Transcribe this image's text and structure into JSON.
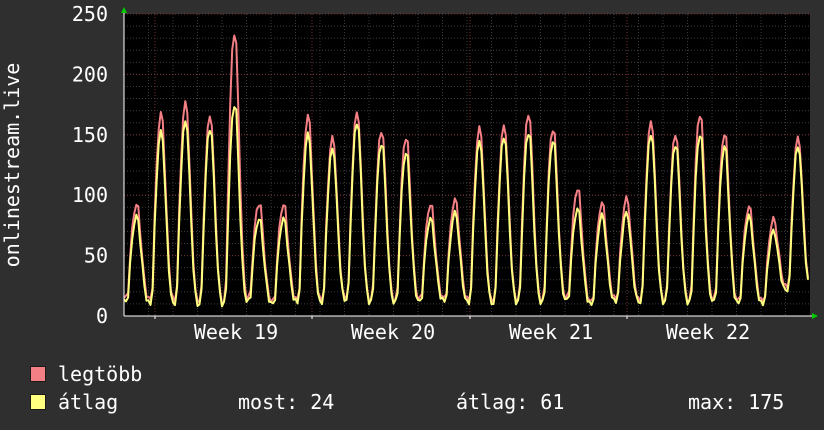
{
  "chart_data": {
    "type": "line",
    "ylabel": "onlinestream.live",
    "xlabel": "",
    "ylim": [
      0,
      250
    ],
    "yticks": [
      0,
      50,
      100,
      150,
      200,
      250
    ],
    "x_tick_labels": [
      "Week 19",
      "Week 20",
      "Week 21",
      "Week 22"
    ],
    "grid": true,
    "series": [
      {
        "name": "legtöbb",
        "color": "#f47f85",
        "daily_peaks": [
          92,
          167,
          176,
          165,
          234,
          93,
          92,
          165,
          147,
          168,
          153,
          148,
          92,
          96,
          155,
          157,
          167,
          155,
          105,
          93,
          97,
          160,
          150,
          167,
          151,
          90,
          80,
          147
        ],
        "daily_lows": [
          15,
          14,
          14,
          13,
          12,
          15,
          12,
          14,
          14,
          16,
          14,
          13,
          14,
          15,
          14,
          13,
          14,
          13,
          15,
          12,
          15,
          14,
          14,
          13,
          14,
          13,
          13,
          25
        ]
      },
      {
        "name": "átlag",
        "color": "#ffff80",
        "daily_peaks": [
          82,
          152,
          161,
          155,
          175,
          80,
          80,
          150,
          138,
          160,
          143,
          135,
          80,
          85,
          144,
          148,
          152,
          145,
          88,
          83,
          85,
          150,
          142,
          150,
          140,
          82,
          70,
          140
        ],
        "daily_lows": [
          12,
          11,
          11,
          10,
          10,
          12,
          10,
          12,
          12,
          14,
          12,
          11,
          12,
          13,
          12,
          11,
          12,
          11,
          13,
          10,
          13,
          12,
          12,
          11,
          12,
          11,
          11,
          22
        ]
      }
    ],
    "legend": [
      {
        "label": "legtöbb",
        "color": "#f47f85"
      },
      {
        "label": "átlag",
        "color": "#ffff80"
      }
    ],
    "stats": {
      "most": "most: 24",
      "atlag": "átlag: 61",
      "max": "max: 175"
    }
  }
}
